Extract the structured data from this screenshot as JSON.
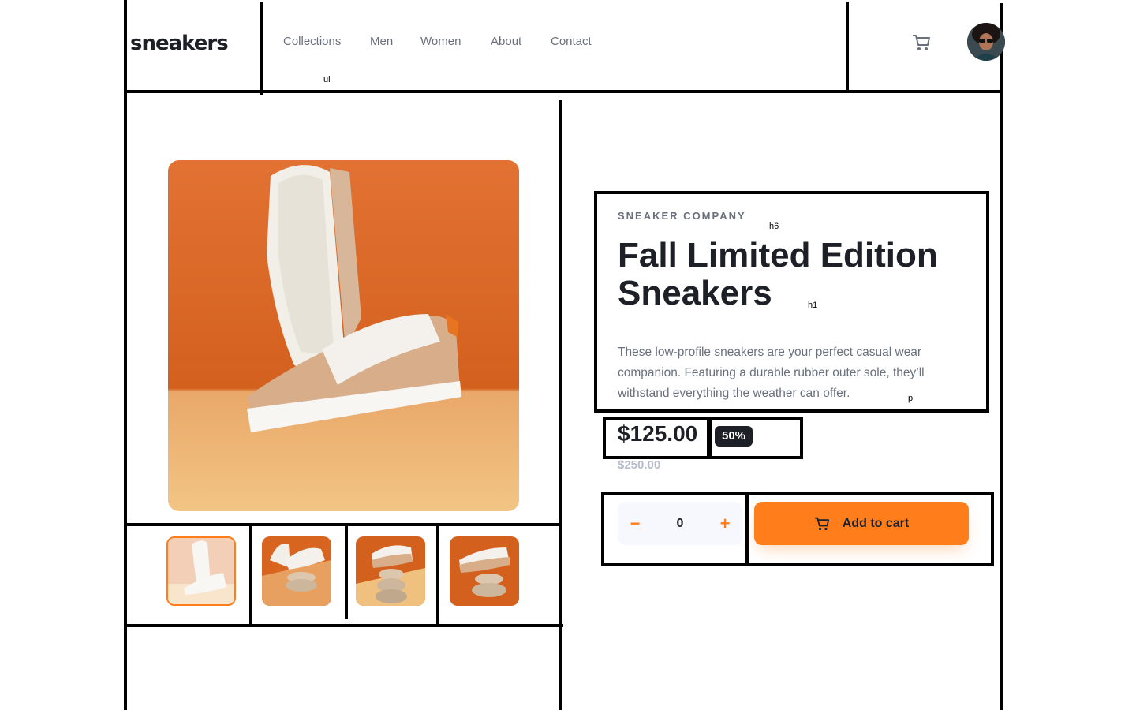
{
  "header": {
    "logo": "sneakers",
    "nav": [
      "Collections",
      "Men",
      "Women",
      "About",
      "Contact"
    ],
    "nav_tag": "ul"
  },
  "product": {
    "company": "SNEAKER COMPANY",
    "company_tag": "h6",
    "title": "Fall Limited Edition Sneakers",
    "title_tag": "h1",
    "description": "These low-profile sneakers are your perfect casual wear companion. Featuring a durable rubber outer sole, they’ll withstand everything the weather can offer.",
    "description_tag": "p",
    "price": "$125.00",
    "discount": "50%",
    "original_price": "$250.00"
  },
  "cart": {
    "minus": "−",
    "quantity": "0",
    "plus": "+",
    "add_label": "Add to cart"
  },
  "colors": {
    "accent": "#ff7e1b",
    "text_dark": "#1d2026",
    "text_grey": "#69707d"
  },
  "icons": [
    "cart-icon",
    "avatar",
    "minus-icon",
    "plus-icon"
  ]
}
